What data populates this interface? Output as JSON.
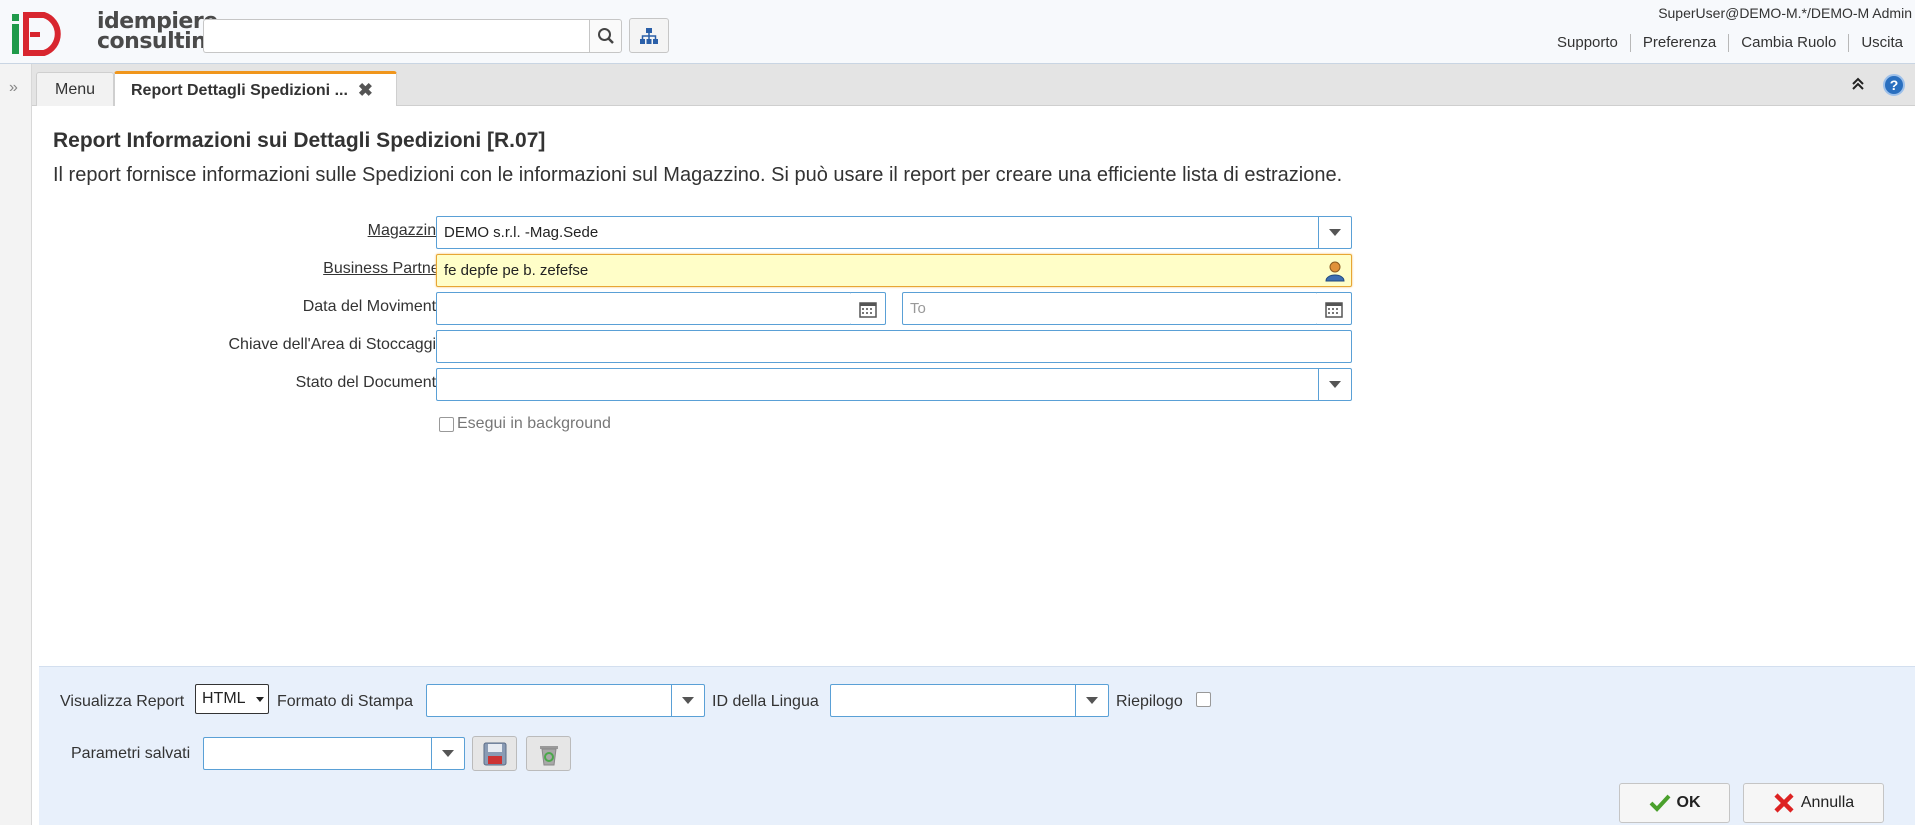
{
  "header": {
    "logo_line1": "idempiere",
    "logo_line2": "consulting",
    "search_value": "",
    "user_info": "SuperUser@DEMO-M.*/DEMO-M Admin",
    "links": [
      "Supporto",
      "Preferenza",
      "Cambia Ruolo",
      "Uscita"
    ]
  },
  "tabs": {
    "menu_label": "Menu",
    "report_label": "Report Dettagli Spedizioni ..."
  },
  "report": {
    "title": "Report Informazioni sui Dettagli Spedizioni [R.07]",
    "description": "Il report fornisce informazioni sulle Spedizioni con le informazioni sul Magazzino. Si può usare il report per creare una efficiente lista di estrazione."
  },
  "params": {
    "warehouse": {
      "label": "Magazzino",
      "value": "DEMO s.r.l. -Mag.Sede"
    },
    "bpartner": {
      "label": "Business Partner",
      "value": "fe depfe pe b. zefefse"
    },
    "movement_date": {
      "label": "Data del Movimento",
      "from_value": "",
      "to_placeholder": "To"
    },
    "locator_key": {
      "label": "Chiave dell'Area di Stoccaggio",
      "value": ""
    },
    "doc_status": {
      "label": "Stato del Documento",
      "value": ""
    },
    "background": {
      "label": "Esegui in background",
      "checked": false
    }
  },
  "bottom": {
    "view_report_label": "Visualizza Report",
    "view_report_value": "HTML",
    "print_format_label": "Formato di Stampa",
    "language_label": "ID della Lingua",
    "summary_label": "Riepilogo",
    "saved_params_label": "Parametri salvati",
    "ok_label": "OK",
    "cancel_label": "Annulla"
  },
  "colors": {
    "accent_tab": "#f0961c",
    "field_border": "#5aa0d6",
    "mandatory_bg": "#fffec8",
    "bottom_bg": "#e8f0fb"
  }
}
